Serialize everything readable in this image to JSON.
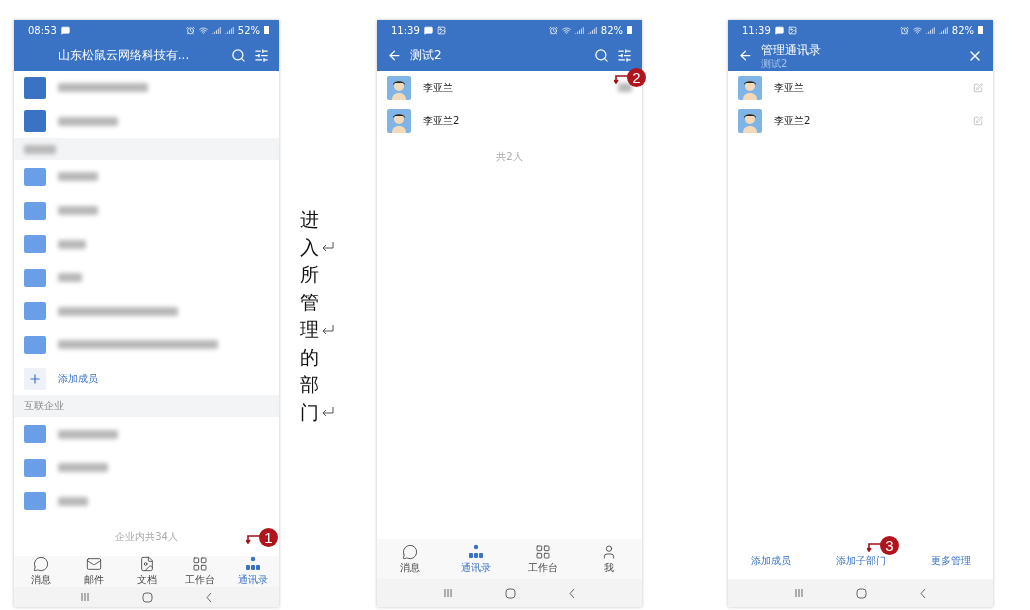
{
  "phones": [
    {
      "status_bar": {
        "time": "08:53",
        "battery": "52%",
        "icons": [
          {
            "kind": "message"
          }
        ]
      },
      "header": {
        "title": "山东松鼠云网络科技有...",
        "actions": [
          {
            "kind": "search"
          },
          {
            "kind": "filter"
          }
        ]
      },
      "rows": [
        {
          "kind": "blurred-unit"
        },
        {
          "kind": "blurred-unit"
        },
        {
          "kind": "blurred-section"
        },
        {
          "kind": "blurred-folder"
        },
        {
          "kind": "blurred-folder"
        },
        {
          "kind": "blurred-folder"
        },
        {
          "kind": "blurred-folder"
        },
        {
          "kind": "blurred-folder"
        },
        {
          "kind": "blurred-folder"
        },
        {
          "kind": "add",
          "label": "添加成员"
        },
        {
          "kind": "section",
          "label": "互联企业"
        },
        {
          "kind": "blurred-folder"
        },
        {
          "kind": "blurred-folder"
        },
        {
          "kind": "blurred-folder"
        }
      ],
      "footer": "企业内共34人",
      "nav": [
        {
          "label": "消息",
          "kind": "chat",
          "selected": false
        },
        {
          "label": "邮件",
          "kind": "mail",
          "selected": false
        },
        {
          "label": "文档",
          "kind": "doc",
          "selected": false
        },
        {
          "label": "工作台",
          "kind": "grid",
          "selected": false
        },
        {
          "label": "通讯录",
          "kind": "org",
          "selected": true
        }
      ],
      "marker": {
        "number": "1",
        "kind": "nav"
      }
    },
    {
      "status_bar": {
        "time": "11:39",
        "battery": "82%",
        "icons": [
          {
            "kind": "message"
          },
          {
            "kind": "image"
          }
        ]
      },
      "header": {
        "title": "测试2",
        "leading": {
          "kind": "back"
        },
        "actions": [
          {
            "kind": "search"
          },
          {
            "kind": "filter"
          }
        ]
      },
      "rows": [
        {
          "kind": "contact",
          "label": "李亚兰",
          "trailing": {
            "kind": "blurred"
          }
        },
        {
          "kind": "contact",
          "label": "李亚兰2"
        }
      ],
      "footer": "共2人",
      "nav": [
        {
          "label": "消息",
          "kind": "chat",
          "selected": false
        },
        {
          "label": "通讯录",
          "kind": "org",
          "selected": true
        },
        {
          "label": "工作台",
          "kind": "grid",
          "selected": false
        },
        {
          "label": "我",
          "kind": "person",
          "selected": false
        }
      ],
      "marker": {
        "number": "2",
        "kind": "header"
      }
    },
    {
      "status_bar": {
        "time": "11:39",
        "battery": "82%",
        "icons": [
          {
            "kind": "message"
          },
          {
            "kind": "image"
          }
        ]
      },
      "header": {
        "title": "管理通讯录",
        "subtitle": "测试2",
        "leading": {
          "kind": "back"
        },
        "actions": [
          {
            "kind": "close"
          }
        ]
      },
      "rows": [
        {
          "kind": "contact",
          "label": "李亚兰",
          "trailing": {
            "kind": "edit"
          }
        },
        {
          "kind": "contact",
          "label": "李亚兰2",
          "trailing": {
            "kind": "edit"
          }
        }
      ],
      "bottom_actions": [
        "添加成员",
        "添加子部门",
        "更多管理"
      ],
      "marker": {
        "number": "3",
        "kind": "actions"
      }
    }
  ],
  "caption": "进入所管理的部门"
}
